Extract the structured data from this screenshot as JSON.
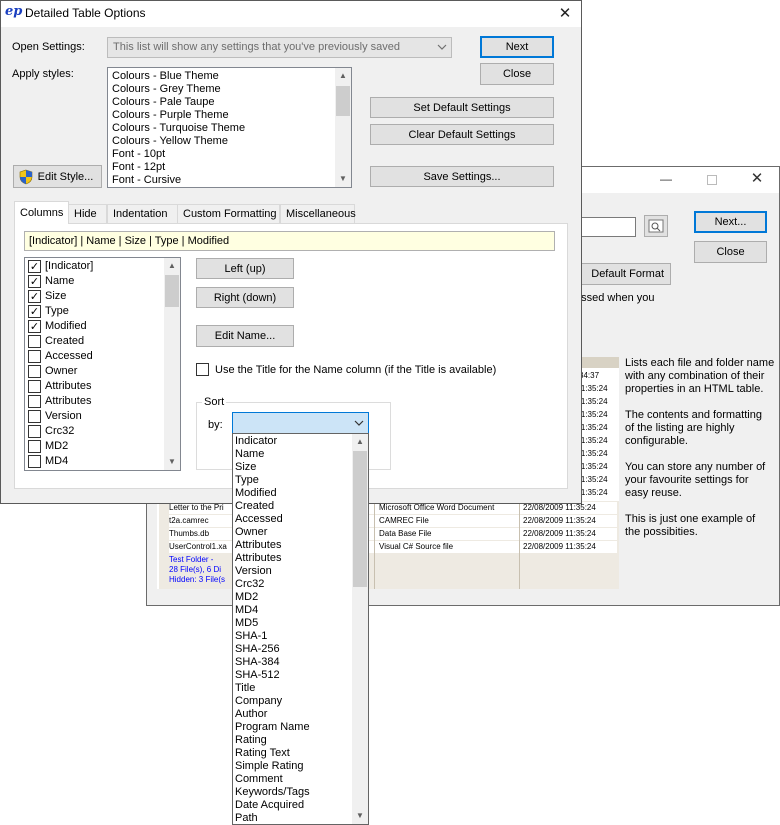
{
  "bg_window": {
    "next_label": "Next...",
    "close_label": "Close",
    "default_format_label": "Default Format",
    "partial_text": "essed when you",
    "description": [
      "Lists each file and folder name",
      "with any combination of their",
      "properties in an HTML table.",
      "",
      "The contents and formatting",
      "of the listing are highly",
      "configurable.",
      "",
      "You can store any number of",
      "your favourite settings for",
      "easy reuse.",
      "",
      "This is just one example of",
      "the possibities."
    ],
    "preview": {
      "times": [
        "34:37",
        "11:35:24",
        "11:35:24",
        "11:35:24",
        "11:35:24",
        "11:35:24",
        "11:35:24",
        "11:35:24",
        "11:35:24",
        "11:35:24"
      ],
      "rows": [
        {
          "name": "Letter to the Pri",
          "type": "Microsoft Office Word Document",
          "date": "22/08/2009 11:35:24"
        },
        {
          "name": "t2a.camrec",
          "type": "CAMREC File",
          "date": "22/08/2009 11:35:24"
        },
        {
          "name": "Thumbs.db",
          "type": "Data Base File",
          "date": "22/08/2009 11:35:24"
        },
        {
          "name": "UserControl1.xa",
          "type": "Visual C# Source file",
          "date": "22/08/2009 11:35:24"
        }
      ],
      "footer": [
        "Test Folder - ",
        "28 File(s), 6 Di",
        "Hidden: 3 File(s"
      ]
    }
  },
  "dialog": {
    "title": "Detailed Table Options",
    "app_icon_text": "ep",
    "open_settings_label": "Open Settings:",
    "open_settings_placeholder": "This list will show any settings that you've previously saved",
    "apply_styles_label": "Apply styles:",
    "styles": [
      "Colours - Blue Theme",
      "Colours - Grey Theme",
      "Colours - Pale Taupe",
      "Colours - Purple Theme",
      "Colours - Turquoise Theme",
      "Colours - Yellow Theme",
      "Font - 10pt",
      "Font - 12pt",
      "Font - Cursive"
    ],
    "buttons": {
      "next": "Next",
      "close": "Close",
      "set_default": "Set Default Settings",
      "clear_default": "Clear Default Settings",
      "save_settings": "Save Settings...",
      "edit_style": "Edit Style..."
    },
    "tabs": [
      "Columns",
      "Hide",
      "Indentation",
      "Custom Formatting",
      "Miscellaneous"
    ],
    "column_order": "[Indicator] | Name | Size | Type | Modified",
    "columns": [
      {
        "label": "[Indicator]",
        "checked": true
      },
      {
        "label": "Name",
        "checked": true
      },
      {
        "label": "Size",
        "checked": true
      },
      {
        "label": "Type",
        "checked": true
      },
      {
        "label": "Modified",
        "checked": true
      },
      {
        "label": "Created",
        "checked": false
      },
      {
        "label": "Accessed",
        "checked": false
      },
      {
        "label": "Owner",
        "checked": false
      },
      {
        "label": "Attributes",
        "checked": false
      },
      {
        "label": "Attributes",
        "checked": false
      },
      {
        "label": "Version",
        "checked": false
      },
      {
        "label": "Crc32",
        "checked": false
      },
      {
        "label": "MD2",
        "checked": false
      },
      {
        "label": "MD4",
        "checked": false
      }
    ],
    "left_up": "Left (up)",
    "right_down": "Right (down)",
    "edit_name": "Edit Name...",
    "use_title_label": "Use the Title for the Name column (if the Title is available)",
    "sort_group_label": "Sort",
    "sort_by_label": "by:",
    "sort_by_value": "",
    "sort_options": [
      "Indicator",
      "Name",
      "Size",
      "Type",
      "Modified",
      "Created",
      "Accessed",
      "Owner",
      "Attributes",
      "Attributes",
      "Version",
      "Crc32",
      "MD2",
      "MD4",
      "MD5",
      "SHA-1",
      "SHA-256",
      "SHA-384",
      "SHA-512",
      "Title",
      "Company",
      "Author",
      "Program Name",
      "Rating",
      "Rating Text",
      "Simple Rating",
      "Comment",
      "Keywords/Tags",
      "Date Acquired",
      "Path"
    ]
  },
  "colors": {
    "window_bg": "#f0f0f0",
    "accent_blue": "#0078d7",
    "order_bar_bg": "#ffffe1",
    "dropdown_select_bg": "#cce4f7",
    "preview_row_bg": "#eeeae2",
    "preview_link": "#0000ff"
  },
  "icons": [
    "app-ep-icon",
    "close-icon",
    "minimize-icon",
    "maximize-icon",
    "shield-icon",
    "chevron-down-icon",
    "search-folder-icon",
    "checkmark-icon"
  ]
}
